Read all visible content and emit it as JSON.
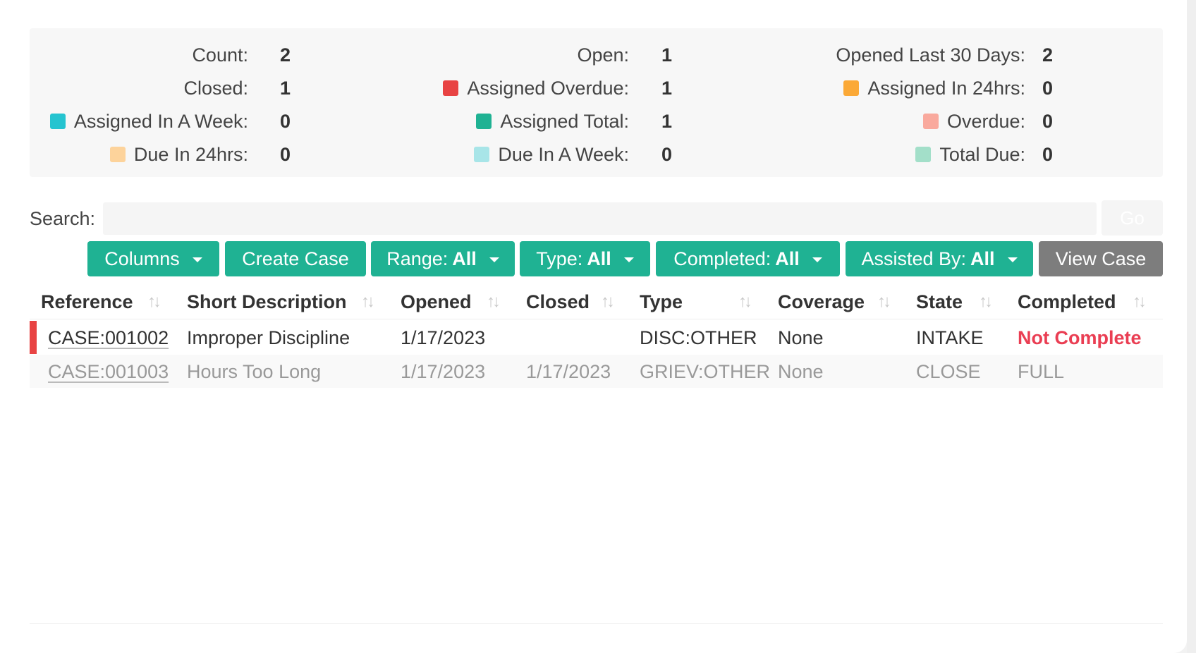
{
  "stats": {
    "col1": [
      {
        "label": "Count:",
        "value": "2",
        "swatch": ""
      },
      {
        "label": "Closed:",
        "value": "1",
        "swatch": ""
      },
      {
        "label": "Assigned In A Week:",
        "value": "0",
        "swatch": "#25c4d0"
      },
      {
        "label": "Due In 24hrs:",
        "value": "0",
        "swatch": "#fdd39b"
      }
    ],
    "col2": [
      {
        "label": "Open:",
        "value": "1",
        "swatch": ""
      },
      {
        "label": "Assigned Overdue:",
        "value": "1",
        "swatch": "#e84343"
      },
      {
        "label": "Assigned Total:",
        "value": "1",
        "swatch": "#1fb293"
      },
      {
        "label": "Due In A Week:",
        "value": "0",
        "swatch": "#a8e5e8"
      }
    ],
    "col3": [
      {
        "label": "Opened Last 30 Days:",
        "value": "2",
        "swatch": ""
      },
      {
        "label": "Assigned In 24hrs:",
        "value": "0",
        "swatch": "#fba937"
      },
      {
        "label": "Overdue:",
        "value": "0",
        "swatch": "#f9a99d"
      },
      {
        "label": "Total Due:",
        "value": "0",
        "swatch": "#a3dfc9"
      }
    ]
  },
  "search": {
    "label": "Search:",
    "placeholder": "",
    "go_label": "Go"
  },
  "toolbar": {
    "columns": "Columns",
    "create_case": "Create Case",
    "range_prefix": "Range:",
    "range_value": "All",
    "type_prefix": "Type:",
    "type_value": "All",
    "completed_prefix": "Completed:",
    "completed_value": "All",
    "assisted_prefix": "Assisted By:",
    "assisted_value": "All",
    "view_case": "View Case"
  },
  "colors": {
    "accent": "#1fb293",
    "gray_button": "#7d7d7d",
    "alert": "#e84343",
    "not_complete": "#ea3e53"
  },
  "table": {
    "headers": [
      "Reference",
      "Short Description",
      "Opened",
      "Closed",
      "Type",
      "Coverage",
      "State",
      "Completed"
    ],
    "rows": [
      {
        "reference": "CASE:001002",
        "description": "Improper Discipline",
        "opened": "1/17/2023",
        "closed": "",
        "type": "DISC:OTHER",
        "coverage": "None",
        "state": "INTAKE",
        "completed": "Not Complete"
      },
      {
        "reference": "CASE:001003",
        "description": "Hours Too Long",
        "opened": "1/17/2023",
        "closed": "1/17/2023",
        "type": "GRIEV:OTHER",
        "coverage": "None",
        "state": "CLOSE",
        "completed": "FULL"
      }
    ]
  }
}
